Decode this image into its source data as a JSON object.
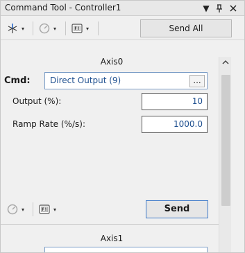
{
  "window": {
    "title": "Command Tool - Controller1",
    "controls": {
      "pin_glyph": "↓",
      "dock_glyph": "И",
      "close_glyph": "✕"
    }
  },
  "toolbar": {
    "send_all_label": "Send All",
    "items": [
      {
        "icon": "asterisk-icon",
        "dropdown": "▾"
      },
      {
        "icon": "gauge-icon",
        "dropdown": "▾"
      },
      {
        "icon": "f1-function-key-icon",
        "dropdown": "▾"
      }
    ]
  },
  "axes": [
    {
      "name": "Axis0",
      "cmd_label": "Cmd:",
      "cmd_value": "Direct Output (9)",
      "browse_label": "...",
      "fields": [
        {
          "label": "Output (%):",
          "value": "10"
        },
        {
          "label": "Ramp Rate (%/s):",
          "value": "1000.0"
        }
      ],
      "send_label": "Send"
    },
    {
      "name": "Axis1"
    }
  ],
  "scrollbar": {
    "up_arrow": "˄"
  },
  "colors": {
    "accent_blue": "#3c78c8",
    "value_text": "#1e4f8f"
  }
}
